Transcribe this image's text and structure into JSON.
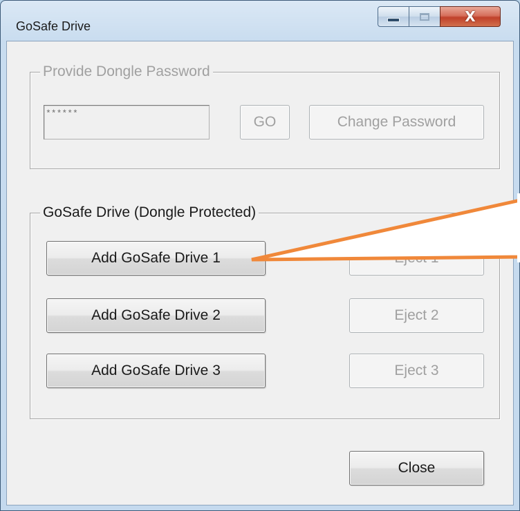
{
  "window": {
    "title": "GoSafe Drive",
    "close_glyph": "X"
  },
  "password_group": {
    "label": "Provide Dongle Password",
    "password_value": "******",
    "go_label": "GO",
    "change_password_label": "Change Password"
  },
  "drive_group": {
    "label": "GoSafe Drive (Dongle Protected)",
    "drives": [
      {
        "add_label": "Add GoSafe Drive 1",
        "eject_label": "Eject 1"
      },
      {
        "add_label": "Add GoSafe Drive 2",
        "eject_label": "Eject 2"
      },
      {
        "add_label": "Add GoSafe Drive 3",
        "eject_label": "Eject 3"
      }
    ]
  },
  "footer": {
    "close_label": "Close"
  },
  "colors": {
    "annotation_arrow": "#f0883a",
    "disabled_text": "#a0a0a0",
    "window_frame": "#c4d9ee"
  },
  "icons": {
    "minimize": "minimize-icon",
    "maximize": "maximize-icon",
    "close": "close-icon"
  }
}
